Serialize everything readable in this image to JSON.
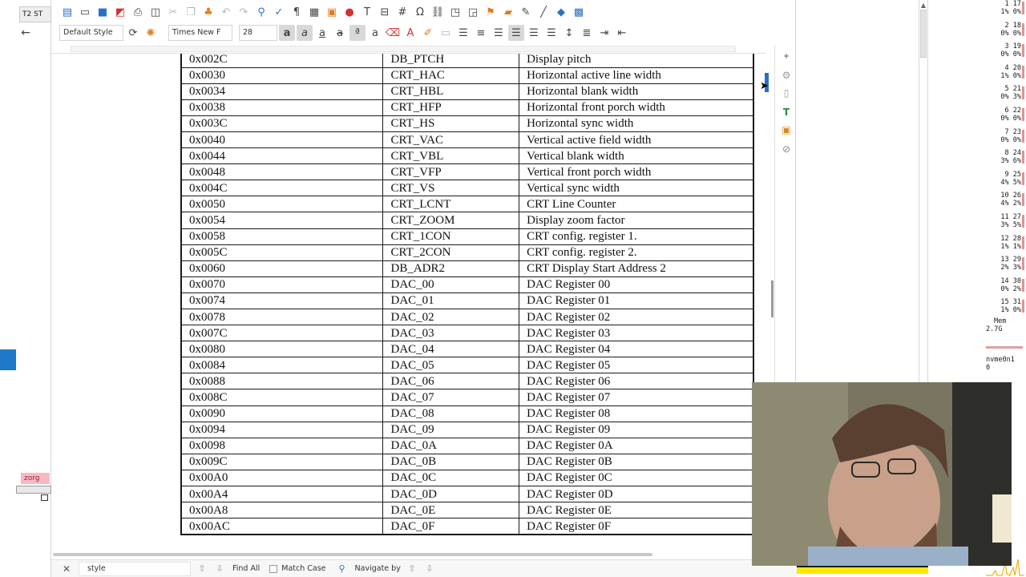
{
  "taskbar": {
    "tab_label": "T2 ST",
    "zorg_badge": "zorg"
  },
  "toolbar": {
    "paragraph_style": "Default Style",
    "font_name": "Times New F",
    "font_size": "28"
  },
  "findbar": {
    "search_value": "style",
    "find_all": "Find All",
    "match_case": "Match Case",
    "navigate_by": "Navigate by"
  },
  "registers": [
    {
      "addr": "0x002C",
      "name": "DB_PTCH",
      "desc": "Display pitch"
    },
    {
      "addr": "0x0030",
      "name": "CRT_HAC",
      "desc": "Horizontal active line width"
    },
    {
      "addr": "0x0034",
      "name": "CRT_HBL",
      "desc": "Horizontal blank width"
    },
    {
      "addr": "0x0038",
      "name": "CRT_HFP",
      "desc": "Horizontal front porch width"
    },
    {
      "addr": "0x003C",
      "name": "CRT_HS",
      "desc": "Horizontal sync width"
    },
    {
      "addr": "0x0040",
      "name": "CRT_VAC",
      "desc": "Vertical active field width"
    },
    {
      "addr": "0x0044",
      "name": "CRT_VBL",
      "desc": "Vertical blank width"
    },
    {
      "addr": "0x0048",
      "name": "CRT_VFP",
      "desc": "Vertical front porch width"
    },
    {
      "addr": "0x004C",
      "name": "CRT_VS",
      "desc": "Vertical sync width"
    },
    {
      "addr": "0x0050",
      "name": "CRT_LCNT",
      "desc": "CRT Line Counter"
    },
    {
      "addr": "0x0054",
      "name": "CRT_ZOOM",
      "desc": "Display zoom factor"
    },
    {
      "addr": "0x0058",
      "name": "CRT_1CON",
      "desc": "CRT config. register 1."
    },
    {
      "addr": "0x005C",
      "name": "CRT_2CON",
      "desc": "CRT config. register 2."
    },
    {
      "addr": "0x0060",
      "name": "DB_ADR2",
      "desc": "CRT Display Start Address 2"
    },
    {
      "addr": "0x0070",
      "name": "DAC_00",
      "desc": "DAC Register 00"
    },
    {
      "addr": "0x0074",
      "name": "DAC_01",
      "desc": "DAC Register 01"
    },
    {
      "addr": "0x0078",
      "name": "DAC_02",
      "desc": "DAC Register 02"
    },
    {
      "addr": "0x007C",
      "name": "DAC_03",
      "desc": "DAC Register 03"
    },
    {
      "addr": "0x0080",
      "name": "DAC_04",
      "desc": "DAC Register 04"
    },
    {
      "addr": "0x0084",
      "name": "DAC_05",
      "desc": "DAC Register 05"
    },
    {
      "addr": "0x0088",
      "name": "DAC_06",
      "desc": "DAC Register 06"
    },
    {
      "addr": "0x008C",
      "name": "DAC_07",
      "desc": "DAC Register 07"
    },
    {
      "addr": "0x0090",
      "name": "DAC_08",
      "desc": "DAC Register 08"
    },
    {
      "addr": "0x0094",
      "name": "DAC_09",
      "desc": "DAC Register 09"
    },
    {
      "addr": "0x0098",
      "name": "DAC_0A",
      "desc": "DAC Register 0A"
    },
    {
      "addr": "0x009C",
      "name": "DAC_0B",
      "desc": "DAC Register 0B"
    },
    {
      "addr": "0x00A0",
      "name": "DAC_0C",
      "desc": "DAC Register 0C"
    },
    {
      "addr": "0x00A4",
      "name": "DAC_0D",
      "desc": "DAC Register 0D"
    },
    {
      "addr": "0x00A8",
      "name": "DAC_0E",
      "desc": "DAC Register 0E"
    },
    {
      "addr": "0x00AC",
      "name": "DAC_0F",
      "desc": "DAC Register 0F"
    }
  ],
  "sysmon": {
    "cpus": [
      {
        "r1": "1 17",
        "r2": "1% 0%"
      },
      {
        "r1": "2 18",
        "r2": "0% 0%"
      },
      {
        "r1": "3 19",
        "r2": "0% 0%"
      },
      {
        "r1": "4 20",
        "r2": "1% 0%"
      },
      {
        "r1": "5 21",
        "r2": "0% 3%"
      },
      {
        "r1": "6 22",
        "r2": "0% 0%"
      },
      {
        "r1": "7 23",
        "r2": "0% 0%"
      },
      {
        "r1": "8 24",
        "r2": "3% 6%"
      },
      {
        "r1": "9 25",
        "r2": "4% 5%"
      },
      {
        "r1": "10 26",
        "r2": "4% 2%"
      },
      {
        "r1": "11 27",
        "r2": "3% 5%"
      },
      {
        "r1": "12 28",
        "r2": "1% 1%"
      },
      {
        "r1": "13 29",
        "r2": "2% 3%"
      },
      {
        "r1": "14 30",
        "r2": "0% 2%"
      },
      {
        "r1": "15 31",
        "r2": "1% 0%"
      }
    ],
    "mem_label": "Mem",
    "mem_value": "2.7G",
    "disk_label": "nvme0n1",
    "disk_value": "0"
  }
}
